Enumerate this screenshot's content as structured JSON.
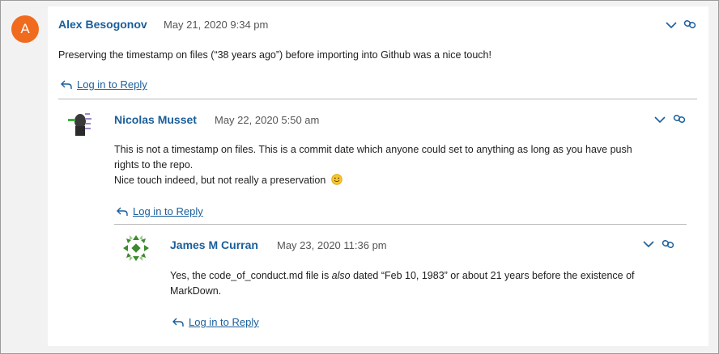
{
  "comments": [
    {
      "author": "Alex Besogonov",
      "avatar_letter": "A",
      "date": "May 21, 2020 9:34 pm",
      "body": [
        "Preserving the timestamp on files (“38 years ago”) before importing into Github was a nice touch!"
      ],
      "reply_label": "Log in to Reply"
    },
    {
      "author": "Nicolas Musset",
      "date": "May 22, 2020 5:50 am",
      "body": [
        "This is not a timestamp on files. This is a commit date which anyone could set to anything as long as you have push",
        "rights to the repo.",
        "Nice touch indeed, but not really a preservation"
      ],
      "reply_label": "Log in to Reply"
    },
    {
      "author": "James M Curran",
      "date": "May 23, 2020 11:36 pm",
      "body_prefix": "Yes, the code_of_conduct.md file is ",
      "body_emph": "also",
      "body_suffix": " dated “Feb 10, 1983” or about 21 years before the existence of",
      "body_line2": "MarkDown.",
      "reply_label": "Log in to Reply"
    }
  ],
  "colors": {
    "link": "#1a5e9a",
    "avatar_bg": "#f06b1e"
  },
  "icons": [
    "chevron-down-icon",
    "link-icon",
    "reply-arrow-icon",
    "smiley-icon"
  ]
}
